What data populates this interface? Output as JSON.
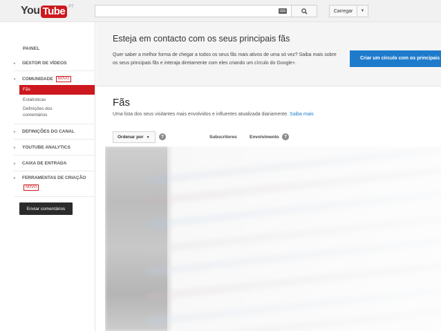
{
  "header": {
    "logo_you": "You",
    "logo_tube": "Tube",
    "logo_region": "PT",
    "search_placeholder": "",
    "upload_label": "Carregar",
    "upload_caret": "▼"
  },
  "sidebar": {
    "section_label": "PAINEL",
    "items": [
      {
        "label": "GESTOR DE VÍDEOS"
      },
      {
        "label": "COMUNIDADE",
        "badge": "NOVO"
      },
      {
        "label": "DEFINIÇÕES DO CANAL"
      },
      {
        "label": "YOUTUBE ANALYTICS"
      },
      {
        "label": "CAIXA DE ENTRADA"
      },
      {
        "label": "FERRAMENTAS DE CRIAÇÃO",
        "badge": "NOVO"
      }
    ],
    "community_subitems": [
      "Fãs",
      "Estatísticas",
      "Definições dos comentários"
    ],
    "feedback_button": "Enviar comentários"
  },
  "promo": {
    "title": "Esteja em contacto com os seus principais fãs",
    "text": "Quer saber a melhor forma de chegar a todos os seus fãs mais ativos de uma só vez? Saiba mais sobre os seus principais fãs e interaja diretamente com eles criando um círculo do Google+.",
    "button": "Criar um círculo com os principais"
  },
  "fans": {
    "title": "Fãs",
    "description": "Uma lista dos seus visitantes mais envolvidos e influentes atualizada diariamente.",
    "learn_more": "Saiba mais",
    "order_by": "Ordenar por",
    "col_subscribers": "Subscritores",
    "col_engagement": "Envolvimento",
    "help_glyph": "?"
  }
}
